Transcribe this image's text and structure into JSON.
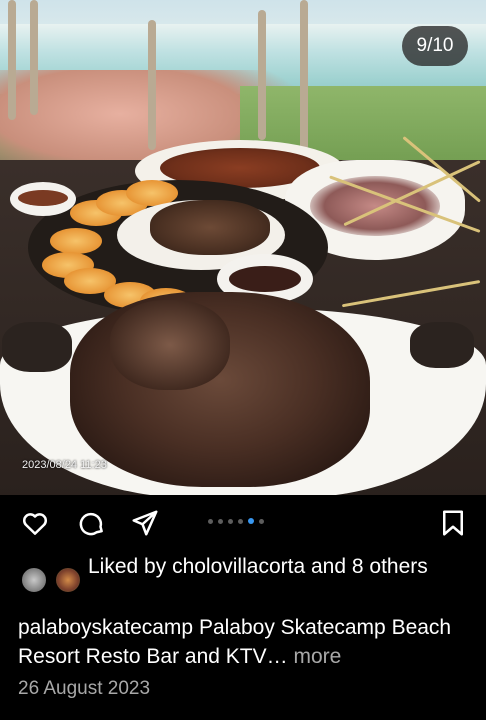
{
  "post": {
    "image_counter": "9/10",
    "photo_timestamp": "2023/08/24 11:23",
    "carousel": {
      "total_dots": 6,
      "active_index": 4
    },
    "likes": {
      "prefix": "Liked by",
      "user": "cholovillacorta",
      "connector": "and",
      "others": "8 others"
    },
    "caption": {
      "username": "palaboyskatecamp",
      "text": "Palaboy Skatecamp Beach Resort Resto Bar and KTV",
      "ellipsis": "…",
      "more_label": "more"
    },
    "date": "26 August 2023"
  },
  "icons": {
    "like": "heart-icon",
    "comment": "comment-icon",
    "share": "send-icon",
    "save": "bookmark-icon"
  },
  "colors": {
    "background": "#000000",
    "text": "#ffffff",
    "muted": "#a8a8a8",
    "active_dot": "#3897f0",
    "inactive_dot": "#5d5d5d"
  }
}
